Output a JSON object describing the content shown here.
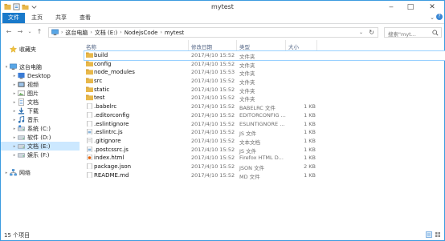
{
  "window": {
    "title": "mytest"
  },
  "ribbon": {
    "tabs": [
      "文件",
      "主页",
      "共享",
      "查看"
    ],
    "help": "?"
  },
  "address": {
    "segments": [
      "这台电脑",
      "文档 (E:)",
      "NodejsCode",
      "mytest"
    ],
    "search_placeholder": "搜索\"myt..."
  },
  "nav": {
    "favorites": "收藏夹",
    "thispc": "这台电脑",
    "items": [
      "Desktop",
      "视频",
      "图片",
      "文档",
      "下载",
      "音乐",
      "系统 (C:)",
      "软件 (D:)",
      "文档 (E:)",
      "娱乐 (F:)"
    ],
    "network": "网络"
  },
  "columns": {
    "name": "名称",
    "date": "修改日期",
    "type": "类型",
    "size": "大小"
  },
  "files": [
    {
      "name": "build",
      "date": "2017/4/10 15:52",
      "type": "文件夹",
      "size": "",
      "icon": "folder"
    },
    {
      "name": "config",
      "date": "2017/4/10 15:52",
      "type": "文件夹",
      "size": "",
      "icon": "folder"
    },
    {
      "name": "node_modules",
      "date": "2017/4/10 15:53",
      "type": "文件夹",
      "size": "",
      "icon": "folder"
    },
    {
      "name": "src",
      "date": "2017/4/10 15:52",
      "type": "文件夹",
      "size": "",
      "icon": "folder"
    },
    {
      "name": "static",
      "date": "2017/4/10 15:52",
      "type": "文件夹",
      "size": "",
      "icon": "folder"
    },
    {
      "name": "test",
      "date": "2017/4/10 15:52",
      "type": "文件夹",
      "size": "",
      "icon": "folder"
    },
    {
      "name": ".babelrc",
      "date": "2017/4/10 15:52",
      "type": "BABELRC 文件",
      "size": "1 KB",
      "icon": "file"
    },
    {
      "name": ".editorconfig",
      "date": "2017/4/10 15:52",
      "type": "EDITORCONFIG ...",
      "size": "1 KB",
      "icon": "file"
    },
    {
      "name": ".eslintignore",
      "date": "2017/4/10 15:52",
      "type": "ESLINTIGNORE ...",
      "size": "1 KB",
      "icon": "file"
    },
    {
      "name": ".eslintrc.js",
      "date": "2017/4/10 15:52",
      "type": "JS 文件",
      "size": "1 KB",
      "icon": "js"
    },
    {
      "name": ".gitignore",
      "date": "2017/4/10 15:52",
      "type": "文本文档",
      "size": "1 KB",
      "icon": "txt"
    },
    {
      "name": ".postcssrc.js",
      "date": "2017/4/10 15:52",
      "type": "JS 文件",
      "size": "1 KB",
      "icon": "js"
    },
    {
      "name": "index.html",
      "date": "2017/4/10 15:52",
      "type": "Firefox HTML D...",
      "size": "1 KB",
      "icon": "html"
    },
    {
      "name": "package.json",
      "date": "2017/4/10 15:52",
      "type": "JSON 文件",
      "size": "2 KB",
      "icon": "file"
    },
    {
      "name": "README.md",
      "date": "2017/4/10 15:52",
      "type": "MD 文件",
      "size": "1 KB",
      "icon": "file"
    }
  ],
  "status": {
    "count": "15 个项目"
  },
  "colors": {
    "accent": "#1979ca",
    "folder": "#e8b84a",
    "selection": "#cce8ff"
  }
}
